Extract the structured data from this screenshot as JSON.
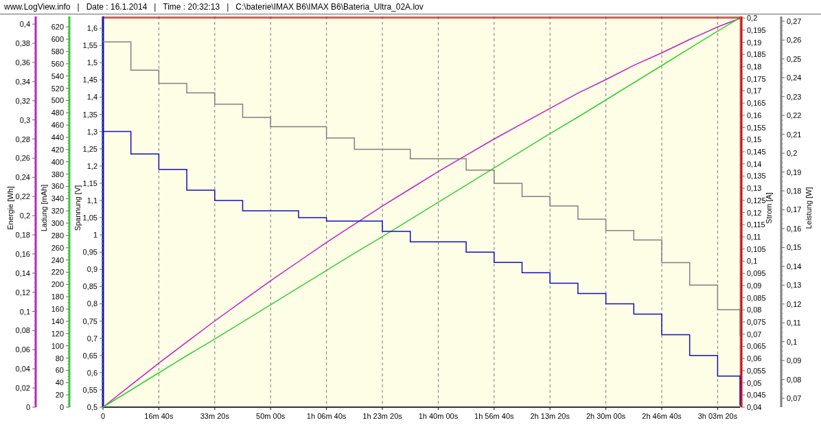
{
  "header": {
    "text": "www.LogView.info   |   Date : 16.1.2014   |   Time : 20:32:13   |   C:\\baterie\\IMAX B6\\IMAX B6\\Bateria_Ultra_02A.lov"
  },
  "chart": {
    "x_labels": [
      "0",
      "16m 40s",
      "33m 20s",
      "50m 00s",
      "1h 06m 40s",
      "1h 23m 20s",
      "1h 40m 00s",
      "1h 56m 40s",
      "2h 13m 20s",
      "2h 30m 00s",
      "2h 46m 40s",
      "3h 03m 20s"
    ],
    "y_axes": [
      {
        "title": "Energie [Wh]",
        "ticks": [
          "0,4",
          "0,38",
          "0,36",
          "0,34",
          "0,32",
          "0,3",
          "0,28",
          "0,26",
          "0,24",
          "0,22",
          "0,2",
          "0,18",
          "0,16",
          "0,14",
          "0,12",
          "0,1",
          "0,08",
          "0,06",
          "0,04",
          "0,02",
          "0"
        ]
      },
      {
        "title": "Ladung [mAh]",
        "ticks": [
          "620",
          "600",
          "580",
          "560",
          "540",
          "520",
          "500",
          "480",
          "460",
          "440",
          "420",
          "400",
          "380",
          "360",
          "340",
          "320",
          "300",
          "280",
          "260",
          "240",
          "220",
          "200",
          "180",
          "160",
          "140",
          "120",
          "100",
          "80",
          "60",
          "40",
          "20",
          "0"
        ]
      },
      {
        "title": "Spannung [V]",
        "ticks": [
          "1,6",
          "1,55",
          "1,5",
          "1,45",
          "1,4",
          "1,35",
          "1,3",
          "1,25",
          "1,2",
          "1,15",
          "1,1",
          "1,05",
          "1",
          "0,95",
          "0,9",
          "0,85",
          "0,8",
          "0,75",
          "0,7",
          "0,65",
          "0,6",
          "0,55",
          "0,5"
        ]
      },
      {
        "title": "Strom [A]",
        "ticks": [
          "0,2",
          "0,195",
          "0,19",
          "0,185",
          "0,18",
          "0,175",
          "0,17",
          "0,165",
          "0,16",
          "0,155",
          "0,15",
          "0,145",
          "0,14",
          "0,135",
          "0,13",
          "0,125",
          "0,12",
          "0,115",
          "0,11",
          "0,105",
          "0,1",
          "0,095",
          "0,09",
          "0,085",
          "0,08",
          "0,075",
          "0,07",
          "0,065",
          "0,06",
          "0,055",
          "0,05",
          "0,045",
          "0,04"
        ]
      },
      {
        "title": "Leistung [W]",
        "ticks": [
          "0,27",
          "0,26",
          "0,25",
          "0,24",
          "0,23",
          "0,22",
          "0,21",
          "0,2",
          "0,19",
          "0,18",
          "0,17",
          "0,16",
          "0,15",
          "0,14",
          "0,13",
          "0,12",
          "0,11",
          "0,1",
          "0,09",
          "0,08",
          "0,07"
        ]
      }
    ]
  }
}
